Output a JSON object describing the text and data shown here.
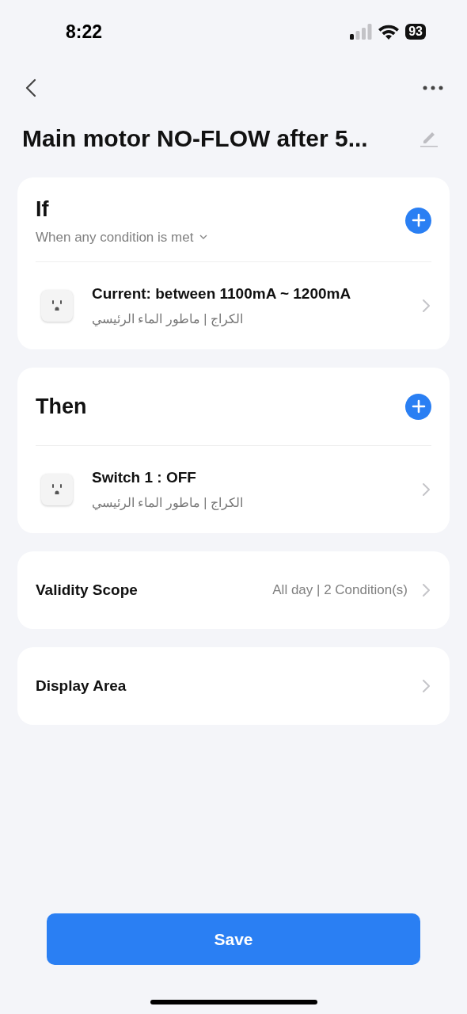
{
  "status_bar": {
    "time": "8:22",
    "battery": "93"
  },
  "title": "Main motor NO-FLOW after 5...",
  "if_card": {
    "heading": "If",
    "condition_mode": "When any condition is met",
    "items": [
      {
        "title": "Current: between 1100mA ~ 1200mA",
        "subtitle": "الكراج | ماطور الماء الرئيسي"
      }
    ]
  },
  "then_card": {
    "heading": "Then",
    "items": [
      {
        "title": "Switch 1 : OFF",
        "subtitle": "الكراج | ماطور الماء الرئيسي"
      }
    ]
  },
  "settings": [
    {
      "label": "Validity Scope",
      "value": "All day | 2 Condition(s)"
    },
    {
      "label": "Display Area"
    }
  ],
  "save_button": "Save"
}
